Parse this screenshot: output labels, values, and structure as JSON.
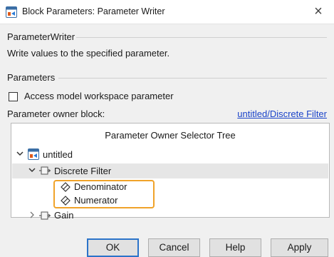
{
  "window": {
    "title": "Block Parameters: Parameter Writer",
    "close_glyph": "×"
  },
  "block": {
    "name": "ParameterWriter",
    "description": "Write values to the specified parameter."
  },
  "parameters": {
    "group_title": "Parameters",
    "checkbox_label": "Access model workspace parameter",
    "checkbox_checked": false,
    "owner_label": "Parameter owner block:",
    "owner_link": "untitled/Discrete Filter"
  },
  "tree": {
    "header": "Parameter Owner Selector Tree",
    "root": {
      "label": "untitled",
      "icon": "model-icon",
      "expanded": true,
      "children": [
        {
          "label": "Discrete Filter",
          "icon": "block-icon",
          "expanded": true,
          "selected": true,
          "children": [
            {
              "label": "Denominator",
              "icon": "parameter-icon"
            },
            {
              "label": "Numerator",
              "icon": "parameter-icon"
            }
          ]
        },
        {
          "label": "Gain",
          "icon": "block-icon",
          "expanded": false
        }
      ]
    },
    "highlight_color": "#f0a32a"
  },
  "buttons": {
    "ok": "OK",
    "cancel": "Cancel",
    "help": "Help",
    "apply": "Apply"
  },
  "colors": {
    "link": "#1a43c9",
    "primary_button_border": "#2b73c9",
    "selected_row": "#e6e6e6"
  }
}
